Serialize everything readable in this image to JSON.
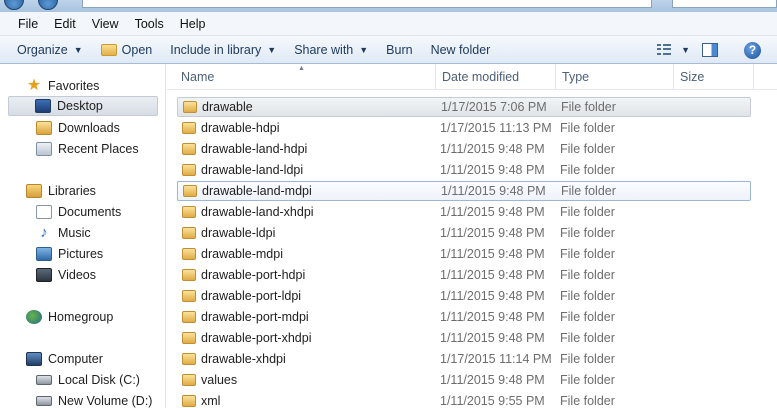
{
  "menu": [
    "File",
    "Edit",
    "View",
    "Tools",
    "Help"
  ],
  "toolbar": {
    "organize": "Organize",
    "open": "Open",
    "include_in_library": "Include in library",
    "share_with": "Share with",
    "burn": "Burn",
    "new_folder": "New folder"
  },
  "nav": {
    "favorites": "Favorites",
    "desktop": "Desktop",
    "downloads": "Downloads",
    "recent_places": "Recent Places",
    "libraries": "Libraries",
    "documents": "Documents",
    "music": "Music",
    "pictures": "Pictures",
    "videos": "Videos",
    "homegroup": "Homegroup",
    "computer": "Computer",
    "local_disk": "Local Disk (C:)",
    "new_volume": "New Volume (D:)"
  },
  "columns": {
    "name": "Name",
    "date_modified": "Date modified",
    "type": "Type",
    "size": "Size"
  },
  "files": [
    {
      "name": "drawable",
      "date": "1/17/2015 7:06 PM",
      "type": "File folder"
    },
    {
      "name": "drawable-hdpi",
      "date": "1/17/2015 11:13 PM",
      "type": "File folder"
    },
    {
      "name": "drawable-land-hdpi",
      "date": "1/11/2015 9:48 PM",
      "type": "File folder"
    },
    {
      "name": "drawable-land-ldpi",
      "date": "1/11/2015 9:48 PM",
      "type": "File folder"
    },
    {
      "name": "drawable-land-mdpi",
      "date": "1/11/2015 9:48 PM",
      "type": "File folder"
    },
    {
      "name": "drawable-land-xhdpi",
      "date": "1/11/2015 9:48 PM",
      "type": "File folder"
    },
    {
      "name": "drawable-ldpi",
      "date": "1/11/2015 9:48 PM",
      "type": "File folder"
    },
    {
      "name": "drawable-mdpi",
      "date": "1/11/2015 9:48 PM",
      "type": "File folder"
    },
    {
      "name": "drawable-port-hdpi",
      "date": "1/11/2015 9:48 PM",
      "type": "File folder"
    },
    {
      "name": "drawable-port-ldpi",
      "date": "1/11/2015 9:48 PM",
      "type": "File folder"
    },
    {
      "name": "drawable-port-mdpi",
      "date": "1/11/2015 9:48 PM",
      "type": "File folder"
    },
    {
      "name": "drawable-port-xhdpi",
      "date": "1/11/2015 9:48 PM",
      "type": "File folder"
    },
    {
      "name": "drawable-xhdpi",
      "date": "1/17/2015 11:14 PM",
      "type": "File folder"
    },
    {
      "name": "values",
      "date": "1/11/2015 9:48 PM",
      "type": "File folder"
    },
    {
      "name": "xml",
      "date": "1/11/2015 9:55 PM",
      "type": "File folder"
    }
  ]
}
